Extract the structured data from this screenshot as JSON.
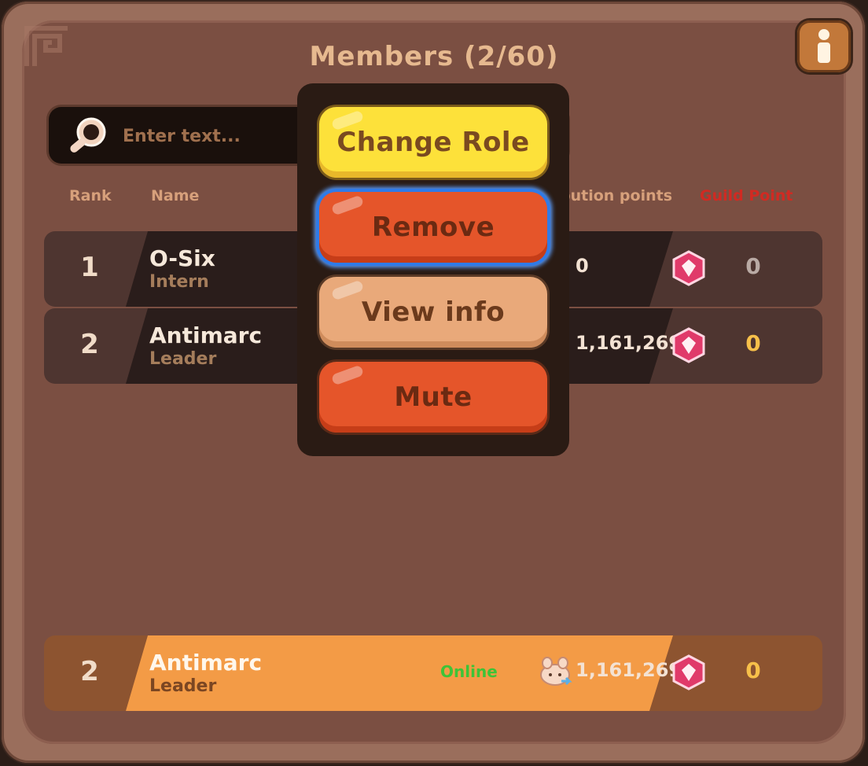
{
  "title": "Members (2/60)",
  "search": {
    "placeholder": "Enter text..."
  },
  "columns": {
    "rank": "Rank",
    "name": "Name",
    "contribution": "bution points",
    "guild_point": "Guild Point"
  },
  "members": [
    {
      "rank": "1",
      "name": "O-Six",
      "role": "Intern",
      "status": "",
      "contribution": "0",
      "guild_point": "0",
      "guild_point_color": "#b9aaa4"
    },
    {
      "rank": "2",
      "name": "Antimarc",
      "role": "Leader",
      "status": "",
      "contribution": "1,161,269",
      "guild_point": "0",
      "guild_point_color": "#f7c04a"
    }
  ],
  "self_row": {
    "rank": "2",
    "name": "Antimarc",
    "role": "Leader",
    "status": "Online",
    "contribution": "1,161,269",
    "guild_point": "0",
    "guild_point_color": "#f7c04a"
  },
  "menu": {
    "change_role": "Change Role",
    "remove": "Remove",
    "view_info": "View info",
    "mute": "Mute"
  },
  "colors": {
    "accent_yellow": "#fde13a",
    "button_red": "#e5552a",
    "selection_blue": "#2f7be8",
    "guild_point_header": "#d12a22",
    "online_green": "#3ec337"
  },
  "icons": {
    "info": "info-icon",
    "search": "magnifier-icon",
    "pet": "pet-icon",
    "guild": "guild-badge-icon"
  }
}
